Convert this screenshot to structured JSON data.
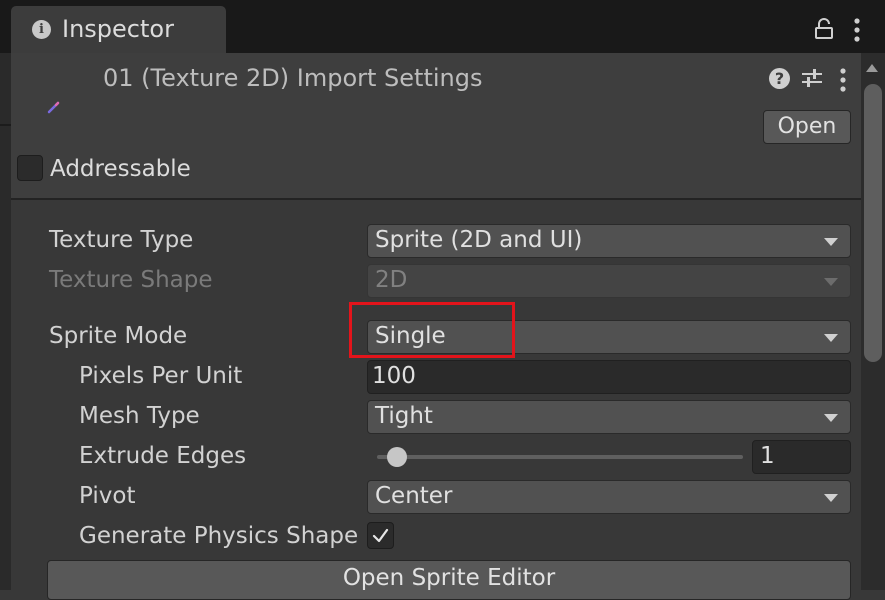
{
  "window": {
    "tab_title": "Inspector",
    "tab_icon": "info-icon"
  },
  "header": {
    "asset_title": "01 (Texture 2D) Import Settings",
    "open_label": "Open",
    "addressable_label": "Addressable",
    "addressable_checked": false
  },
  "fields": {
    "texture_type": {
      "label": "Texture Type",
      "value": "Sprite (2D and UI)"
    },
    "texture_shape": {
      "label": "Texture Shape",
      "value": "2D",
      "disabled": true
    },
    "sprite_mode": {
      "label": "Sprite Mode",
      "value": "Single"
    },
    "pixels_per_unit": {
      "label": "Pixels Per Unit",
      "value": "100"
    },
    "mesh_type": {
      "label": "Mesh Type",
      "value": "Tight"
    },
    "extrude_edges": {
      "label": "Extrude Edges",
      "value": "1",
      "slider_fraction": 0.03
    },
    "pivot": {
      "label": "Pivot",
      "value": "Center"
    },
    "generate_physics_shape": {
      "label": "Generate Physics Shape",
      "checked": true
    }
  },
  "open_sprite_editor_label": "Open Sprite Editor",
  "highlight": {
    "target": "sprite-mode-dropdown",
    "color": "#e3141b"
  },
  "colors": {
    "panel": "#383838",
    "dropdown": "#515151",
    "tabbar": "#191919"
  }
}
